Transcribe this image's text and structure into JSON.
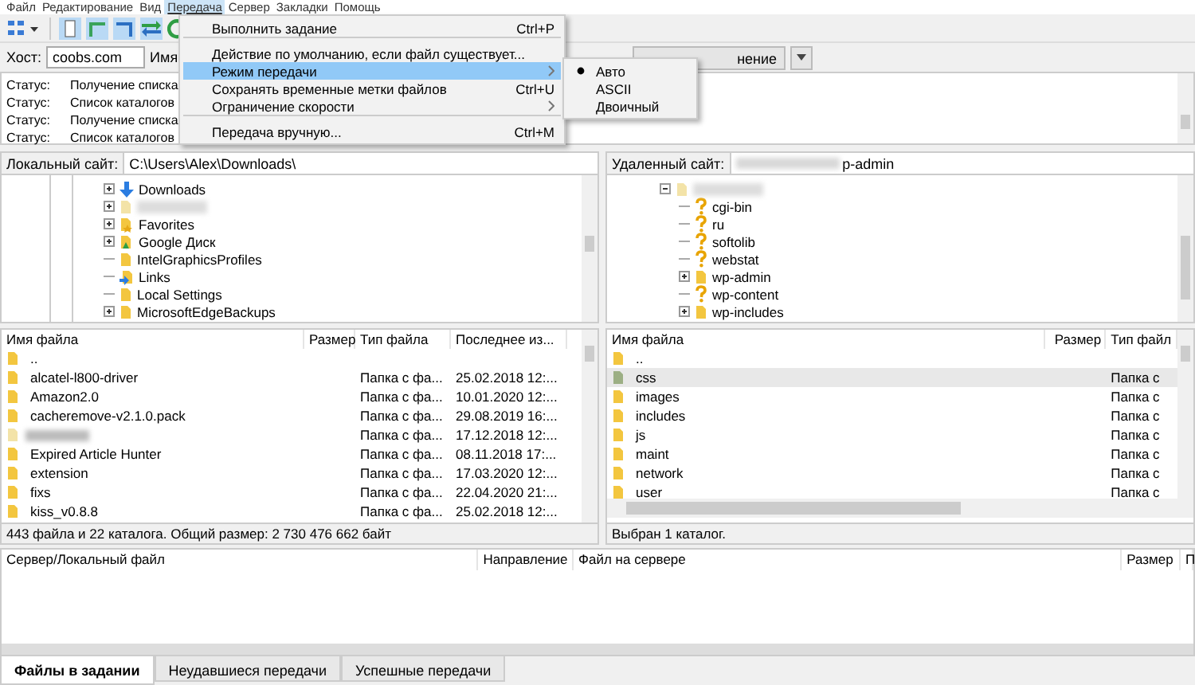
{
  "menu_bar": [
    {
      "label": "Файл",
      "selected": false
    },
    {
      "label": "Редактирование",
      "selected": false
    },
    {
      "label": "Вид",
      "selected": false
    },
    {
      "label": "Передача",
      "selected": true
    },
    {
      "label": "Сервер",
      "selected": false
    },
    {
      "label": "Закладки",
      "selected": false
    },
    {
      "label": "Помощь",
      "selected": false
    }
  ],
  "quickconnect": {
    "host_label": "Хост:",
    "host_value": "coobs.com",
    "user_label": "Имя",
    "connect_button": "нение"
  },
  "log": [
    {
      "label": "Статус:",
      "text": "Получение списка"
    },
    {
      "label": "Статус:",
      "text": "Список каталогов"
    },
    {
      "label": "Статус:",
      "text": "Получение списка"
    },
    {
      "label": "Статус:",
      "text": "Список каталогов"
    }
  ],
  "transfer_menu": [
    {
      "label": "Выполнить задание",
      "shortcut": "Ctrl+P",
      "kind": "command",
      "selected": false,
      "separator_before": false
    },
    {
      "label": "Действие по умолчанию, если файл существует...",
      "kind": "command",
      "selected": false,
      "separator_before": true
    },
    {
      "label": "Режим передачи",
      "kind": "submenu",
      "selected": true,
      "separator_before": false
    },
    {
      "label": "Сохранять временные метки файлов",
      "shortcut": "Ctrl+U",
      "kind": "command",
      "selected": false,
      "separator_before": false
    },
    {
      "label": "Ограничение скорости",
      "kind": "submenu",
      "selected": false,
      "separator_before": false
    },
    {
      "label": "Передача вручную...",
      "shortcut": "Ctrl+M",
      "kind": "command",
      "selected": false,
      "separator_before": true
    }
  ],
  "transfer_mode_menu": [
    {
      "label": "Авто",
      "selected": true
    },
    {
      "label": "ASCII",
      "selected": false
    },
    {
      "label": "Двоичный",
      "selected": false
    }
  ],
  "local_site": {
    "label": "Локальный сайт:",
    "path": "C:\\Users\\Alex\\Downloads\\"
  },
  "local_tree": [
    {
      "kind": "download",
      "name": "Downloads",
      "expandable": true
    },
    {
      "kind": "redacted",
      "expandable": true
    },
    {
      "kind": "favorites",
      "name": "Favorites",
      "expandable": true
    },
    {
      "kind": "gdrive",
      "name": "Google Диск",
      "expandable": true
    },
    {
      "kind": "folder",
      "name": "IntelGraphicsProfiles",
      "expandable": false
    },
    {
      "kind": "link",
      "name": "Links",
      "expandable": false
    },
    {
      "kind": "folder",
      "name": "Local Settings",
      "expandable": false
    },
    {
      "kind": "folder",
      "name": "MicrosoftEdgeBackups",
      "expandable": true
    }
  ],
  "remote_site": {
    "label": "Удаленный сайт:",
    "path": "p-admin"
  },
  "remote_tree": [
    {
      "kind": "redacted",
      "expandable": true,
      "expanded": true,
      "children": [
        {
          "kind": "unknown",
          "name": "cgi-bin",
          "expandable": false
        },
        {
          "kind": "unknown",
          "name": "ru",
          "expandable": false
        },
        {
          "kind": "unknown",
          "name": "softolib",
          "expandable": false
        },
        {
          "kind": "unknown",
          "name": "webstat",
          "expandable": false
        },
        {
          "kind": "folder",
          "name": "wp-admin",
          "expandable": true
        },
        {
          "kind": "unknown",
          "name": "wp-content",
          "expandable": false
        },
        {
          "kind": "folder",
          "name": "wp-includes",
          "expandable": true
        }
      ]
    }
  ],
  "local_files": {
    "columns": [
      "Имя файла",
      "Размер",
      "Тип файла",
      "Последнее из..."
    ],
    "rows": [
      {
        "kind": "parent",
        "name": ".."
      },
      {
        "kind": "folder",
        "name": "alcatel-l800-driver",
        "type": "Папка с фа...",
        "modified": "25.02.2018 12:..."
      },
      {
        "kind": "folder",
        "name": "Amazon2.0",
        "type": "Папка с фа...",
        "modified": "10.01.2020 12:..."
      },
      {
        "kind": "folder",
        "name": "cacheremove-v2.1.0.pack",
        "type": "Папка с фа...",
        "modified": "29.08.2019 16:..."
      },
      {
        "kind": "redacted",
        "type": "Папка с фа...",
        "modified": "17.12.2018 12:..."
      },
      {
        "kind": "folder",
        "name": "Expired Article Hunter",
        "type": "Папка с фа...",
        "modified": "08.11.2018 17:..."
      },
      {
        "kind": "folder",
        "name": "extension",
        "type": "Папка с фа...",
        "modified": "17.03.2020 12:..."
      },
      {
        "kind": "folder",
        "name": "fixs",
        "type": "Папка с фа...",
        "modified": "22.04.2020 21:..."
      },
      {
        "kind": "folder",
        "name": "kiss_v0.8.8",
        "type": "Папка с фа...",
        "modified": "25.02.2018 12:..."
      }
    ]
  },
  "local_status": "443 файла и 22 каталога. Общий размер: 2 730 476 662 байт",
  "remote_files": {
    "columns": [
      "Имя файла",
      "Размер",
      "Тип файл"
    ],
    "rows": [
      {
        "kind": "parent",
        "name": "..",
        "selected": false
      },
      {
        "kind": "folder",
        "name": "css",
        "type": "Папка с",
        "selected": true
      },
      {
        "kind": "folder",
        "name": "images",
        "type": "Папка с",
        "selected": false
      },
      {
        "kind": "folder",
        "name": "includes",
        "type": "Папка с",
        "selected": false
      },
      {
        "kind": "folder",
        "name": "js",
        "type": "Папка с",
        "selected": false
      },
      {
        "kind": "folder",
        "name": "maint",
        "type": "Папка с",
        "selected": false
      },
      {
        "kind": "folder",
        "name": "network",
        "type": "Папка с",
        "selected": false
      },
      {
        "kind": "folder",
        "name": "user",
        "type": "Папка с",
        "selected": false
      }
    ]
  },
  "remote_status": "Выбран 1 каталог.",
  "queue": {
    "columns": [
      "Сервер/Локальный файл",
      "Направление",
      "Файл на сервере",
      "Размер",
      "П"
    ],
    "tabs": [
      {
        "label": "Файлы в задании",
        "selected": true
      },
      {
        "label": "Неудавшиеся передачи",
        "selected": false
      },
      {
        "label": "Успешные передачи",
        "selected": false
      }
    ]
  }
}
